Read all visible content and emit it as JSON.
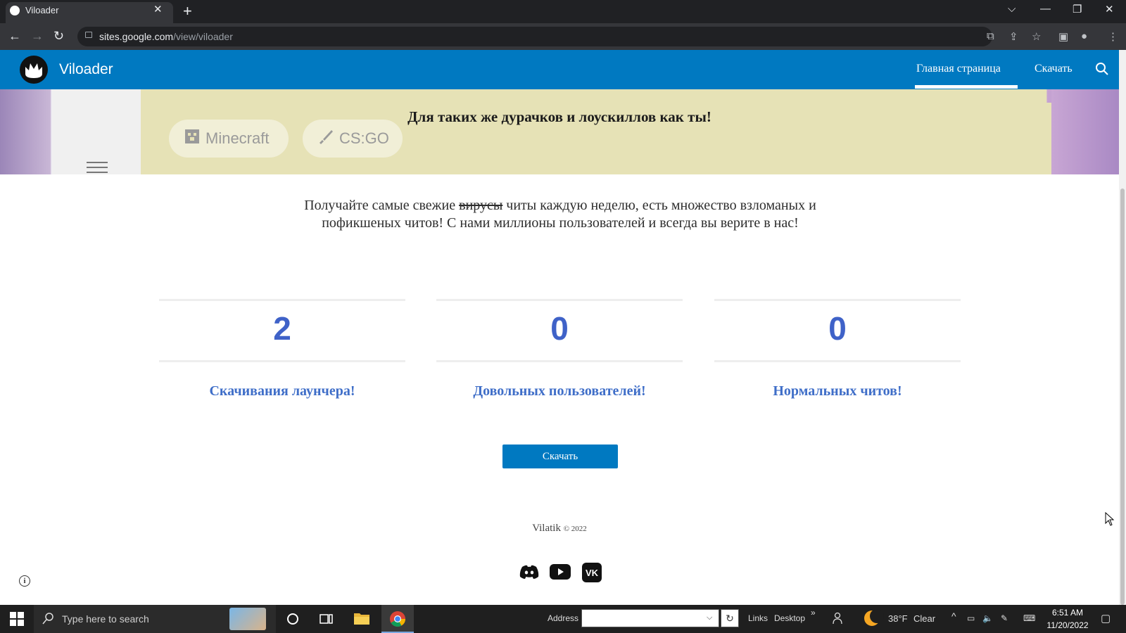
{
  "browser": {
    "tab_title": "Viloader",
    "url_host": "sites.google.com",
    "url_path": "/view/viloader"
  },
  "site": {
    "name": "Viloader",
    "nav": {
      "home": "Главная страница",
      "download": "Скачать"
    }
  },
  "banner": {
    "text": "Для таких же дурачков и лоускиллов как ты!",
    "chips": [
      "Minecraft",
      "CS:GO"
    ]
  },
  "intro": {
    "part1": "Получайте самые свежие ",
    "struck": "вирусы",
    "part2": " читы каждую неделю, есть множество взломаных и пофикшеных читов! С нами миллионы пользователей и всегда вы верите в нас!"
  },
  "stats": [
    {
      "value": "2",
      "label": "Скачивания лаунчера!"
    },
    {
      "value": "0",
      "label": "Довольных пользователей!"
    },
    {
      "value": "0",
      "label": "Нормальных читов!"
    }
  ],
  "download_button": "Скачать",
  "footer": {
    "author": "Vilatik",
    "copyright": "© 2022"
  },
  "social_icons": [
    "discord-icon",
    "youtube-icon",
    "vk-icon"
  ],
  "colors": {
    "header": "#0079c1",
    "stat_number": "#3f62c8",
    "stat_label": "#3f6ec8"
  },
  "taskbar": {
    "search_placeholder": "Type here to search",
    "address_label": "Address",
    "links_label": "Links",
    "desktop_label": "Desktop",
    "weather_temp": "38°F",
    "weather_desc": "Clear",
    "time": "6:51 AM",
    "date": "11/20/2022"
  }
}
